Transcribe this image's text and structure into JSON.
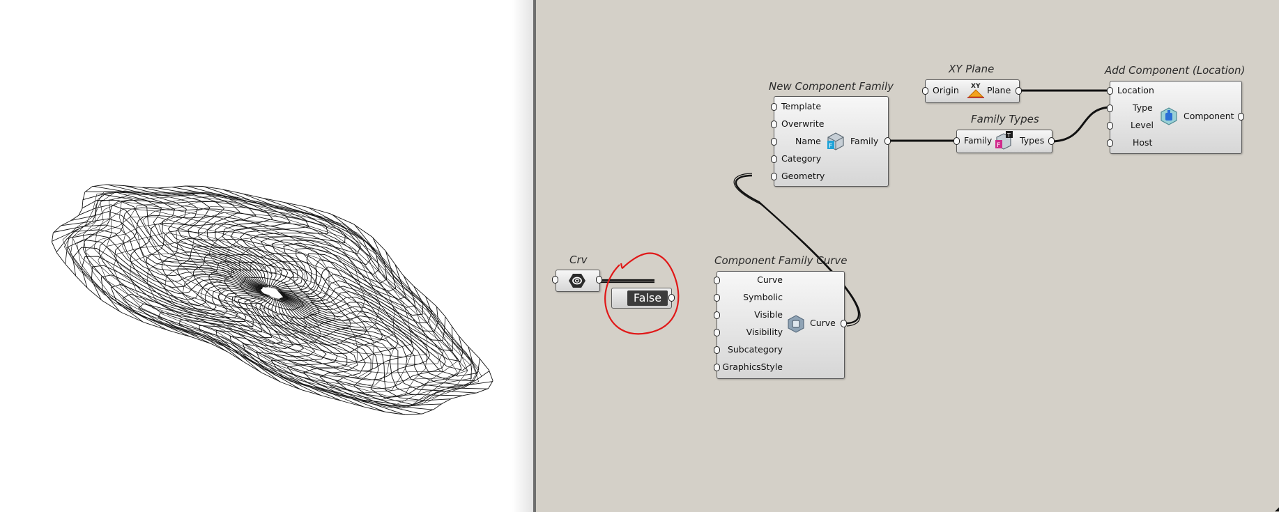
{
  "viewport": {
    "label": ""
  },
  "crv": {
    "title": "Crv"
  },
  "toggle": {
    "value": "False"
  },
  "cfc": {
    "title": "Component Family Curve",
    "inputs": [
      "Curve",
      "Symbolic",
      "Visible",
      "Visibility",
      "Subcategory",
      "GraphicsStyle"
    ],
    "output": "Curve"
  },
  "ncf": {
    "title": "New Component Family",
    "inputs": [
      "Template",
      "Overwrite",
      "Name",
      "Category",
      "Geometry"
    ],
    "output": "Family"
  },
  "xy": {
    "title": "XY Plane",
    "input": "Origin",
    "output": "Plane",
    "badge": "XY"
  },
  "ft": {
    "title": "Family Types",
    "input": "Family",
    "output": "Types",
    "badge": "T"
  },
  "ac": {
    "title": "Add Component (Location)",
    "inputs": [
      "Location",
      "Type",
      "Level",
      "Host"
    ],
    "output": "Component"
  },
  "icons": {
    "crv": "curve-param-icon",
    "cfc": "component-family-curve-icon",
    "ncf": "family-cube-icon",
    "xy": "xy-plane-icon",
    "ft": "family-types-icon",
    "ac": "add-component-icon"
  },
  "colors": {
    "canvas": "#d4d0c8",
    "wire": "#111111",
    "annotation": "#e01818",
    "toggle_value_bg": "#3c3c3c"
  }
}
